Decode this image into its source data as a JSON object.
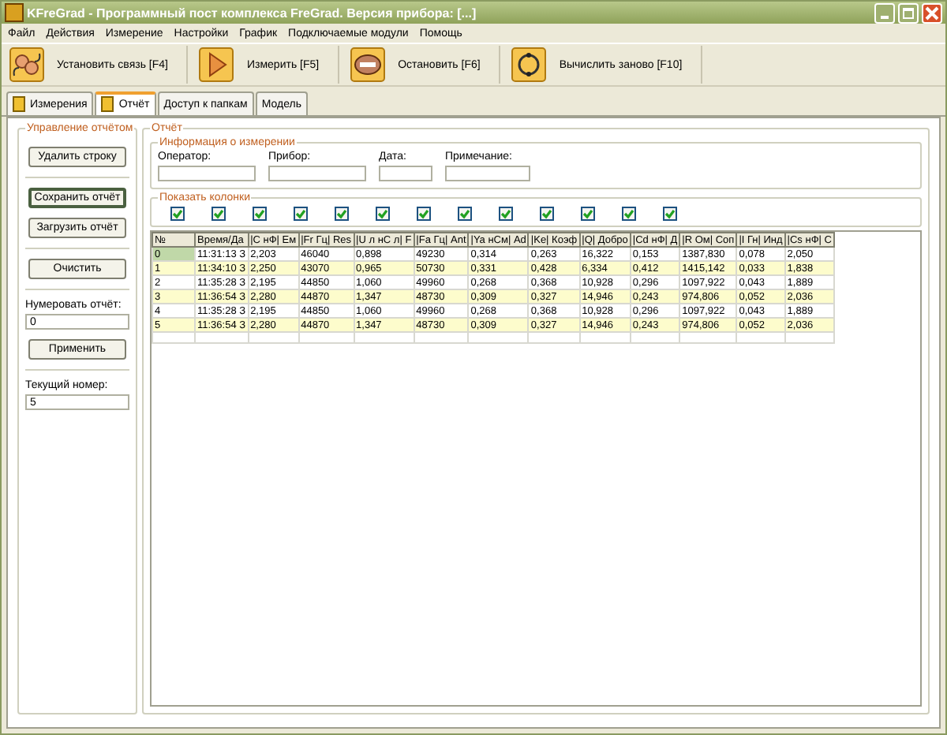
{
  "window": {
    "title": "KFreGrad - Программный пост комплекса FreGrad. Версия прибора: [...]"
  },
  "menu": [
    "Файл",
    "Действия",
    "Измерение",
    "Настройки",
    "График",
    "Подключаемые модули",
    "Помощь"
  ],
  "toolbar": [
    {
      "label": "Установить связь [F4]"
    },
    {
      "label": "Измерить [F5]"
    },
    {
      "label": "Остановить [F6]"
    },
    {
      "label": "Вычислить заново [F10]"
    }
  ],
  "tabs": [
    {
      "label": "Измерения",
      "selected": false,
      "icon": true
    },
    {
      "label": "Отчёт",
      "selected": true,
      "icon": true
    },
    {
      "label": "Доступ к папкам",
      "selected": false,
      "icon": false
    },
    {
      "label": "Модель",
      "selected": false,
      "icon": false
    }
  ],
  "report_control": {
    "title": "Управление отчётом",
    "items": [
      {
        "kind": "button",
        "label": "Удалить строку",
        "focused": false
      },
      {
        "kind": "separator"
      },
      {
        "kind": "button",
        "label": "Сохранить отчёт",
        "focused": true
      },
      {
        "kind": "button",
        "label": "Загрузить отчёт",
        "focused": false
      },
      {
        "kind": "separator"
      },
      {
        "kind": "button",
        "label": "Очистить",
        "focused": false
      },
      {
        "kind": "separator"
      },
      {
        "kind": "field",
        "label": "Нумеровать отчёт:",
        "value": "0"
      },
      {
        "kind": "button",
        "label": "Применить",
        "focused": false
      },
      {
        "kind": "separator"
      },
      {
        "kind": "field",
        "label": "Текущий номер:",
        "value": "5"
      }
    ]
  },
  "report": {
    "title": "Отчёт",
    "info": {
      "title": "Информация о измерении",
      "fields": [
        {
          "label": "Оператор:"
        },
        {
          "label": "Прибор:"
        },
        {
          "label": "Дата:"
        },
        {
          "label": "Примечание:"
        }
      ]
    },
    "columns_group": {
      "title": "Показать колонки",
      "checkboxes": [
        {
          "checked": true
        },
        {
          "checked": true
        },
        {
          "checked": true
        },
        {
          "checked": true
        },
        {
          "checked": true
        },
        {
          "checked": true
        },
        {
          "checked": true
        },
        {
          "checked": true
        },
        {
          "checked": true
        },
        {
          "checked": true
        },
        {
          "checked": true
        },
        {
          "checked": true
        },
        {
          "checked": true
        }
      ]
    },
    "table": {
      "columns": [
        "№",
        "Время/Да",
        "|C нФ| Ем",
        "|Fr Гц| Res",
        "|U л нС л| F",
        "|Fa Гц| Ant",
        "|Ya нСм| Ad",
        "|Ke| Коэф",
        "|Q| Добро",
        "|Cd нФ| Д",
        "|R Ом| Соп",
        "|I Гн| Инд",
        "|Cs нФ| С"
      ],
      "rows": [
        {
          "selected": true,
          "cells": [
            "0",
            "11:31:13 З",
            "2,203",
            "46040",
            "0,898",
            "49230",
            "0,314",
            "0,263",
            "16,322",
            "0,153",
            "1387,830",
            "0,078",
            "2,050"
          ]
        },
        {
          "selected": false,
          "cells": [
            "1",
            "11:34:10 З",
            "2,250",
            "43070",
            "0,965",
            "50730",
            "0,331",
            "0,428",
            "6,334",
            "0,412",
            "1415,142",
            "0,033",
            "1,838"
          ]
        },
        {
          "selected": false,
          "cells": [
            "2",
            "11:35:28 З",
            "2,195",
            "44850",
            "1,060",
            "49960",
            "0,268",
            "0,368",
            "10,928",
            "0,296",
            "1097,922",
            "0,043",
            "1,889"
          ]
        },
        {
          "selected": false,
          "cells": [
            "3",
            "11:36:54 З",
            "2,280",
            "44870",
            "1,347",
            "48730",
            "0,309",
            "0,327",
            "14,946",
            "0,243",
            "974,806",
            "0,052",
            "2,036"
          ]
        },
        {
          "selected": false,
          "cells": [
            "4",
            "11:35:28 З",
            "2,195",
            "44850",
            "1,060",
            "49960",
            "0,268",
            "0,368",
            "10,928",
            "0,296",
            "1097,922",
            "0,043",
            "1,889"
          ]
        },
        {
          "selected": false,
          "cells": [
            "5",
            "11:36:54 З",
            "2,280",
            "44870",
            "1,347",
            "48730",
            "0,309",
            "0,327",
            "14,946",
            "0,243",
            "974,806",
            "0,052",
            "2,036"
          ]
        }
      ]
    }
  }
}
